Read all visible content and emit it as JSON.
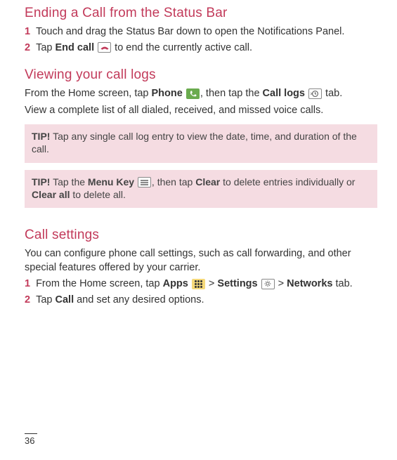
{
  "section1": {
    "heading": "Ending a Call from the Status Bar",
    "step1_num": "1",
    "step1_text": "Touch and drag the Status Bar down to open the Notifications Panel.",
    "step2_num": "2",
    "step2_pre": "Tap ",
    "step2_bold": "End call",
    "step2_post": " to end the currently active call."
  },
  "section2": {
    "heading": "Viewing your call logs",
    "line1_pre": "From the Home screen, tap ",
    "line1_phone": "Phone",
    "line1_mid": ", then tap the ",
    "line1_calllogs": "Call logs",
    "line1_post": " tab.",
    "line2": "View a complete list of all dialed, received, and missed voice calls."
  },
  "tip1": {
    "label": "TIP!",
    "text": " Tap any single call log entry to view the date, time, and duration of the call."
  },
  "tip2": {
    "label": "TIP!",
    "pre": " Tap the ",
    "menukey": "Menu Key",
    "mid1": ", then tap ",
    "clear": "Clear",
    "mid2": " to delete entries individually or ",
    "clearall": "Clear all",
    "post": " to delete all."
  },
  "section3": {
    "heading": "Call settings",
    "line1": "You can configure phone call settings, such as call forwarding, and other special features offered by your carrier.",
    "step1_num": "1",
    "step1_pre": "From the Home screen, tap ",
    "step1_apps": "Apps",
    "step1_gt1": " > ",
    "step1_settings": "Settings",
    "step1_gt2": " > ",
    "step1_networks": "Networks",
    "step1_post": " tab.",
    "step2_num": "2",
    "step2_pre": "Tap ",
    "step2_call": "Call",
    "step2_post": " and set any desired options."
  },
  "page_number": "36"
}
